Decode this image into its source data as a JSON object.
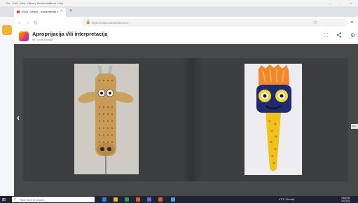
{
  "menubar": {
    "items": [
      "File",
      "Edit",
      "View",
      "History",
      "Bookmarks",
      "Tools",
      "Help"
    ]
  },
  "browser": {
    "tab_title": "Book Creator - Aproprijacija i/…",
    "tab_close": "×",
    "new_tab": "+",
    "url": "https://read.bookcreator.com/…",
    "star": "☆"
  },
  "book": {
    "title": "Aproprijacija i/ili interpretacija",
    "author": "by Tonka Miožija"
  },
  "viewer": {
    "prev_symbol": "‹",
    "next_tab_label": "Next"
  },
  "taskbar": {
    "search_placeholder": "Type here to search",
    "weather": "47°F Cloudy",
    "time": "9:50 PM",
    "date": "1/1/2024",
    "app_colors": [
      "#3a7bd5",
      "#f0b429",
      "#2d9c5a",
      "#e25b2a",
      "#6a6ad8",
      "#e05a3c",
      "#4aa0e6"
    ]
  },
  "colors": {
    "accent": "#2f6fd6",
    "viewer_bg": "#474849",
    "taskbar_bg": "#1f2333"
  }
}
